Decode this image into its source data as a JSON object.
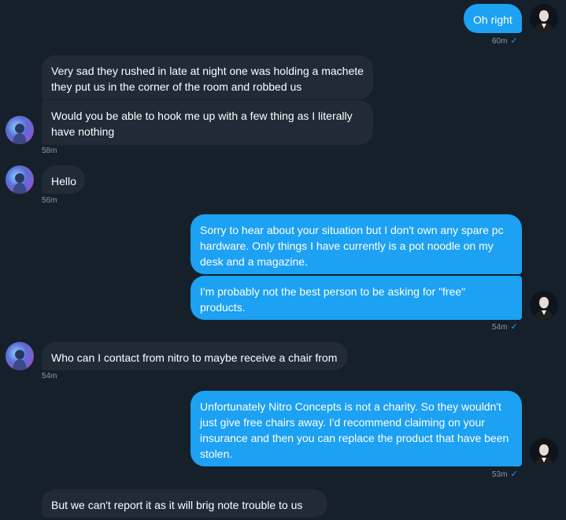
{
  "conversation": {
    "m1": {
      "text": "Oh right",
      "time": "60m"
    },
    "m2": {
      "text": "Very sad they rushed in late at night one was holding a machete\nthey put us in the corner of the room and robbed us"
    },
    "m3": {
      "text": "Would you be able to hook me up with a few thing as I literally\nhave nothing",
      "time": "58m"
    },
    "m4": {
      "text": "Hello",
      "time": "56m"
    },
    "m5": {
      "text": "Sorry to hear about your situation but I don't own any spare pc\nhardware. Only things I have currently is a pot noodle on my\ndesk and a magazine."
    },
    "m6": {
      "text": "I'm probably not the best person to be asking for \"free\"\nproducts.",
      "time": "54m"
    },
    "m7": {
      "text": "Who can I contact from nitro to maybe receive a chair from",
      "time": "54m"
    },
    "m8": {
      "text": "Unfortunately Nitro Concepts is not a charity. So they wouldn't\njust give free chairs away. I'd recommend claiming on your\ninsurance and then you can replace the product that have been\nstolen.",
      "time": "53m"
    },
    "m9": {
      "text": "But we can't report it as it will brig note trouble to us"
    }
  },
  "icons": {
    "read_receipt": "checkmark-icon",
    "self_avatar": "avatar-dark-suit",
    "other_avatar": "avatar-blue-purple"
  },
  "colors": {
    "background": "#15202b",
    "incoming_bubble": "#212a35",
    "outgoing_bubble": "#1da1f2",
    "timestamp": "#8899a6"
  }
}
